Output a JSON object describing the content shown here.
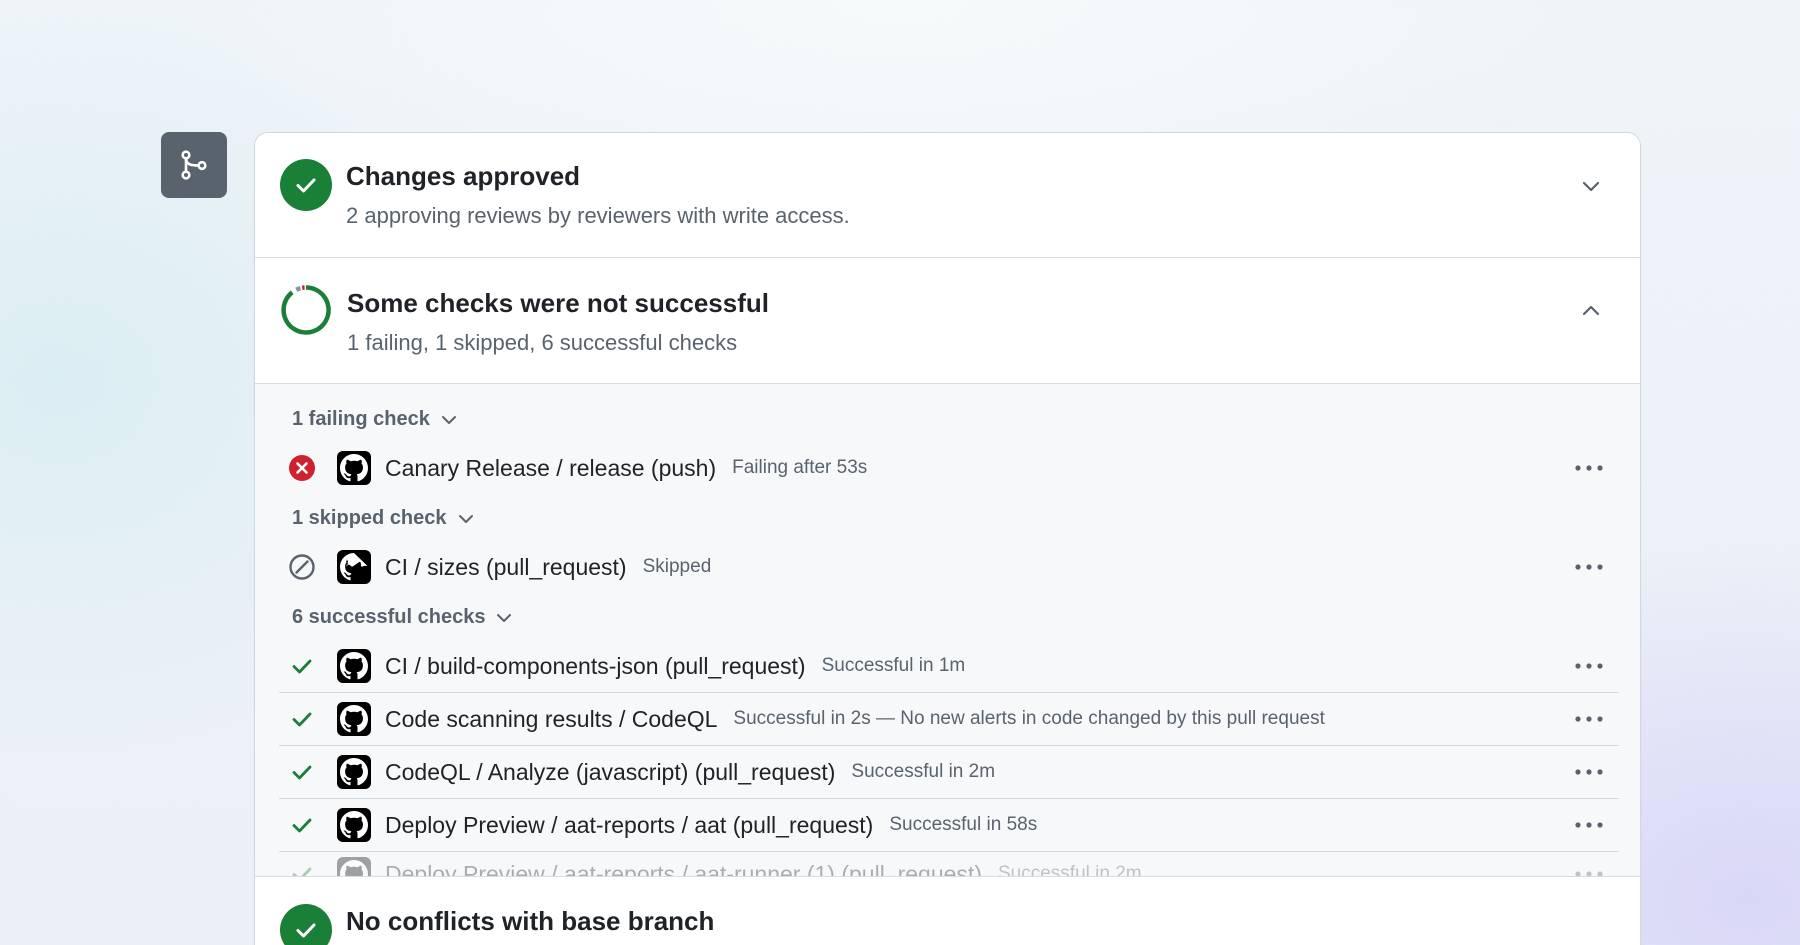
{
  "colors": {
    "success": "#1a7f37",
    "danger": "#cf222e",
    "muted": "#59636e",
    "text": "#1f2328",
    "badge": "#59636e"
  },
  "branch_badge": {
    "icon": "git-branch-icon"
  },
  "approved": {
    "icon": "check-circle-icon",
    "title": "Changes approved",
    "subtitle": "2 approving reviews by reviewers with write access.",
    "toggle_icon": "chevron-down-icon"
  },
  "checks": {
    "icon": "progress-ring-icon",
    "title": "Some checks were not successful",
    "subtitle": "1 failing, 1 skipped, 6 successful checks",
    "toggle_icon": "chevron-up-icon",
    "groups": {
      "failing": {
        "label": "1 failing check",
        "items": [
          {
            "name": "Canary Release / release (push)",
            "meta": "Failing after 53s",
            "status": "failing"
          }
        ]
      },
      "skipped": {
        "label": "1 skipped check",
        "items": [
          {
            "name": "CI / sizes (pull_request)",
            "meta": "Skipped",
            "status": "skipped"
          }
        ]
      },
      "successful": {
        "label": "6 successful checks",
        "items": [
          {
            "name": "CI / build-components-json (pull_request)",
            "meta": "Successful in 1m",
            "status": "success"
          },
          {
            "name": "Code scanning results / CodeQL",
            "meta": "Successful in 2s — No new alerts in code changed by this pull request",
            "status": "success"
          },
          {
            "name": "CodeQL / Analyze (javascript) (pull_request)",
            "meta": "Successful in 2m",
            "status": "success"
          },
          {
            "name": "Deploy Preview / aat-reports / aat (pull_request)",
            "meta": "Successful in 58s",
            "status": "success"
          },
          {
            "name": "Deploy Preview / aat-reports / aat-runner (1) (pull_request)",
            "meta": "Successful in 2m",
            "status": "success"
          }
        ]
      }
    }
  },
  "conflicts": {
    "icon": "check-circle-icon",
    "title": "No conflicts with base branch"
  }
}
